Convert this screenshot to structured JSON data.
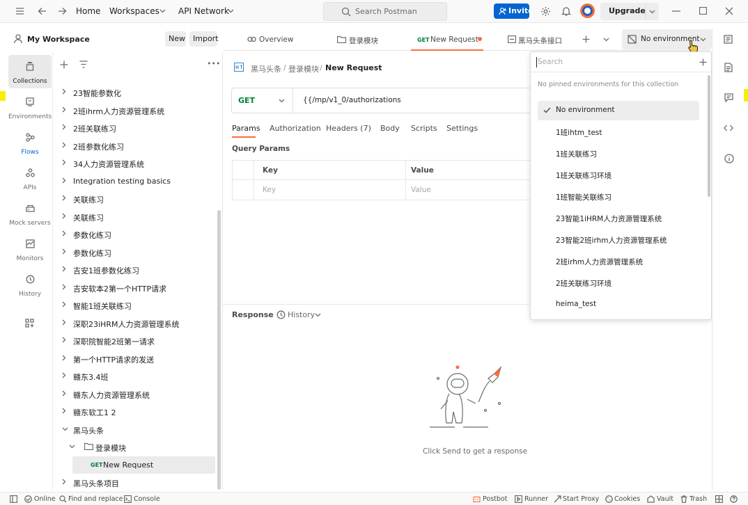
{
  "topbar": {
    "home": "Home",
    "workspaces": "Workspaces",
    "api_network": "API Network",
    "search_placeholder": "Search Postman",
    "invite": "Invite",
    "upgrade": "Upgrade"
  },
  "workspace": {
    "name": "My Workspace",
    "new_label": "New",
    "import_label": "Import"
  },
  "sidebar_nav": [
    {
      "label": "Collections",
      "icon": "collections-icon"
    },
    {
      "label": "Environments",
      "icon": "environments-icon"
    },
    {
      "label": "Flows",
      "icon": "flows-icon"
    },
    {
      "label": "APIs",
      "icon": "apis-icon"
    },
    {
      "label": "Mock servers",
      "icon": "mock-servers-icon"
    },
    {
      "label": "Monitors",
      "icon": "monitors-icon"
    },
    {
      "label": "History",
      "icon": "history-icon"
    }
  ],
  "tree": {
    "items": [
      "23智能参数化",
      "2班ihrm人力资源管理系统",
      "2班关联练习",
      "2班参数化练习",
      "34人力资源管理系统",
      "Integration testing basics",
      "关联练习",
      "关联练习",
      "参数化练习",
      "参数化练习",
      "吉安1班参数化练习",
      "吉安软本2第一个HTTP请求",
      "智能1班关联练习",
      "深职23iHRM人力资源管理系统",
      "深职院智能2班第一请求",
      "第一个HTTP请求的发送",
      "赣东3.4班",
      "赣东人力资源管理系统",
      "赣东软工1 2",
      "黑马头条"
    ],
    "folder": "登录模块",
    "request_method": "GET",
    "request_name": "New Request",
    "last_item": "黑马头条项目"
  },
  "tabs": [
    {
      "label": "Overview"
    },
    {
      "label": "登录模块"
    },
    {
      "method": "GET",
      "label": "New Request"
    },
    {
      "label": "黑马头条接口"
    }
  ],
  "environment": {
    "selected": "No environment",
    "search_placeholder": "Search",
    "pinned_note": "No pinned environments for this collection",
    "options": [
      "No environment",
      "1班ihtm_test",
      "1班关联练习",
      "1班关联练习环境",
      "1班智能关联练习",
      "23智能1iHRM人力资源管理系统",
      "23智能2班irhm人力资源管理系统",
      "2班irhm人力资源管理系统",
      "2班关联练习环境",
      "heima_test"
    ]
  },
  "request": {
    "breadcrumb": [
      "黑马头条",
      "登录模块",
      "New Request"
    ],
    "method": "GET",
    "url": "{{/mp/v1_0/authorizations",
    "tabs": [
      "Params",
      "Authorization",
      "Headers (7)",
      "Body",
      "Scripts",
      "Settings"
    ],
    "query_params_title": "Query Params",
    "col_key": "Key",
    "col_value": "Value",
    "key_placeholder": "Key",
    "value_placeholder": "Value"
  },
  "response": {
    "title": "Response",
    "history": "History",
    "empty_text": "Click Send to get a response"
  },
  "statusbar": {
    "online": "Online",
    "find_replace": "Find and replace",
    "console": "Console",
    "postbot": "Postbot",
    "runner": "Runner",
    "start_proxy": "Start Proxy",
    "cookies": "Cookies",
    "vault": "Vault",
    "trash": "Trash"
  },
  "colors": {
    "accent": "#ff6c37",
    "invite_blue": "#0265d2",
    "get_green": "#007f31"
  }
}
